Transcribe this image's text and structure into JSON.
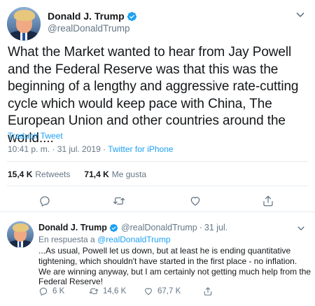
{
  "tweet": {
    "author_name": "Donald J. Trump",
    "author_handle": "@realDonaldTrump",
    "text": "What the Market wanted to hear from Jay Powell and the Federal Reserve was that this was the beginning of a lengthy and aggressive rate-cutting cycle which would keep pace with China, The European Union and other countries around the world....",
    "translate_label": "Traducir Tweet",
    "time": "10:41 p. m. · 31 jul. 2019",
    "separator": " · ",
    "source": "Twitter for iPhone",
    "retweets_count": "15,4 K",
    "retweets_label": "Retweets",
    "likes_count": "71,4 K",
    "likes_label": "Me gusta"
  },
  "reply": {
    "author_name": "Donald J. Trump",
    "author_handle": "@realDonaldTrump",
    "dot": "·",
    "date": "31 jul.",
    "in_reply_prefix": "En respuesta a",
    "in_reply_mention": "@realDonaldTrump",
    "text": "...As usual, Powell let us down, but at least he is ending quantitative tightening, which shouldn't have started in the first place - no inflation. We are winning anyway, but I am certainly not getting much help from the Federal Reserve!",
    "reply_count": "6 K",
    "retweet_count": "14,6 K",
    "like_count": "67,7 K"
  },
  "colors": {
    "accent": "#1da1f2",
    "secondary_text": "#657786",
    "primary_text": "#14171a",
    "divider": "#e6ecf0"
  },
  "icons": [
    "verified-badge-icon",
    "caret-down-icon",
    "reply-icon",
    "retweet-icon",
    "heart-icon",
    "share-icon"
  ]
}
